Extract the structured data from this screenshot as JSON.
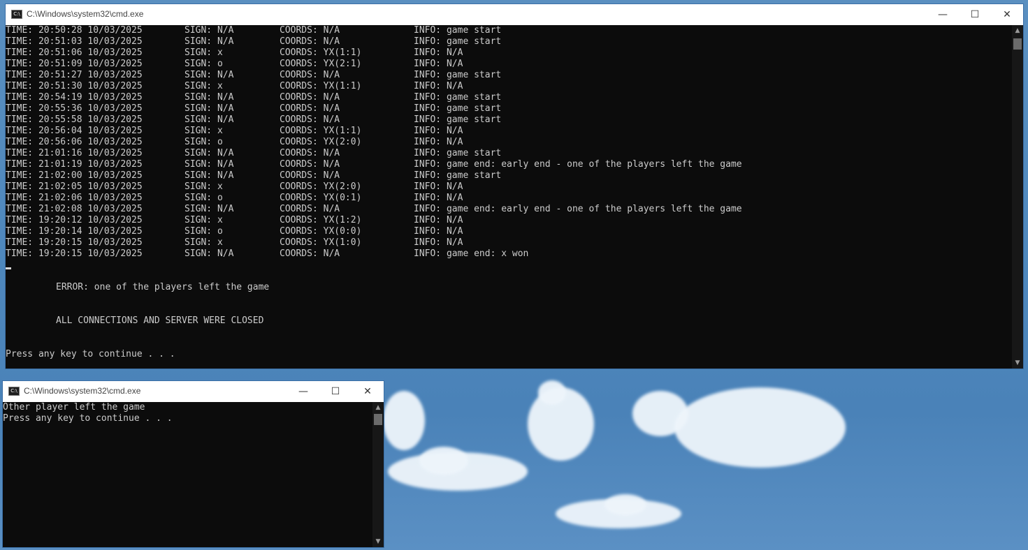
{
  "window1": {
    "title": "C:\\Windows\\system32\\cmd.exe",
    "controls": {
      "minimize": "—",
      "maximize": "☐",
      "close": "✕"
    },
    "log_rows": [
      {
        "time": "TIME: 20:50:28 10/03/2025",
        "sign": "SIGN: N/A",
        "coords": "COORDS: N/A",
        "info": "INFO: game start"
      },
      {
        "time": "TIME: 20:51:03 10/03/2025",
        "sign": "SIGN: N/A",
        "coords": "COORDS: N/A",
        "info": "INFO: game start"
      },
      {
        "time": "TIME: 20:51:06 10/03/2025",
        "sign": "SIGN: x",
        "coords": "COORDS: YX(1:1)",
        "info": "INFO: N/A"
      },
      {
        "time": "TIME: 20:51:09 10/03/2025",
        "sign": "SIGN: o",
        "coords": "COORDS: YX(2:1)",
        "info": "INFO: N/A"
      },
      {
        "time": "TIME: 20:51:27 10/03/2025",
        "sign": "SIGN: N/A",
        "coords": "COORDS: N/A",
        "info": "INFO: game start"
      },
      {
        "time": "TIME: 20:51:30 10/03/2025",
        "sign": "SIGN: x",
        "coords": "COORDS: YX(1:1)",
        "info": "INFO: N/A"
      },
      {
        "time": "TIME: 20:54:19 10/03/2025",
        "sign": "SIGN: N/A",
        "coords": "COORDS: N/A",
        "info": "INFO: game start"
      },
      {
        "time": "TIME: 20:55:36 10/03/2025",
        "sign": "SIGN: N/A",
        "coords": "COORDS: N/A",
        "info": "INFO: game start"
      },
      {
        "time": "TIME: 20:55:58 10/03/2025",
        "sign": "SIGN: N/A",
        "coords": "COORDS: N/A",
        "info": "INFO: game start"
      },
      {
        "time": "TIME: 20:56:04 10/03/2025",
        "sign": "SIGN: x",
        "coords": "COORDS: YX(1:1)",
        "info": "INFO: N/A"
      },
      {
        "time": "TIME: 20:56:06 10/03/2025",
        "sign": "SIGN: o",
        "coords": "COORDS: YX(2:0)",
        "info": "INFO: N/A"
      },
      {
        "time": "TIME: 21:01:16 10/03/2025",
        "sign": "SIGN: N/A",
        "coords": "COORDS: N/A",
        "info": "INFO: game start"
      },
      {
        "time": "TIME: 21:01:19 10/03/2025",
        "sign": "SIGN: N/A",
        "coords": "COORDS: N/A",
        "info": "INFO: game end: early end - one of the players left the game"
      },
      {
        "time": "TIME: 21:02:00 10/03/2025",
        "sign": "SIGN: N/A",
        "coords": "COORDS: N/A",
        "info": "INFO: game start"
      },
      {
        "time": "TIME: 21:02:05 10/03/2025",
        "sign": "SIGN: x",
        "coords": "COORDS: YX(2:0)",
        "info": "INFO: N/A"
      },
      {
        "time": "TIME: 21:02:06 10/03/2025",
        "sign": "SIGN: o",
        "coords": "COORDS: YX(0:1)",
        "info": "INFO: N/A"
      },
      {
        "time": "TIME: 21:02:08 10/03/2025",
        "sign": "SIGN: N/A",
        "coords": "COORDS: N/A",
        "info": "INFO: game end: early end - one of the players left the game"
      },
      {
        "time": "TIME: 19:20:12 10/03/2025",
        "sign": "SIGN: x",
        "coords": "COORDS: YX(1:2)",
        "info": "INFO: N/A"
      },
      {
        "time": "TIME: 19:20:14 10/03/2025",
        "sign": "SIGN: o",
        "coords": "COORDS: YX(0:0)",
        "info": "INFO: N/A"
      },
      {
        "time": "TIME: 19:20:15 10/03/2025",
        "sign": "SIGN: x",
        "coords": "COORDS: YX(1:0)",
        "info": "INFO: N/A"
      },
      {
        "time": "TIME: 19:20:15 10/03/2025",
        "sign": "SIGN: N/A",
        "coords": "COORDS: N/A",
        "info": "INFO: game end: x won"
      }
    ],
    "error_message": "ERROR: one of the players left the game",
    "closed_message": "ALL CONNECTIONS AND SERVER WERE CLOSED",
    "press_key": "Press any key to continue . . ."
  },
  "window2": {
    "title": "C:\\Windows\\system32\\cmd.exe",
    "controls": {
      "minimize": "—",
      "maximize": "☐",
      "close": "✕"
    },
    "line1": "Other player left the game",
    "line2": "Press any key to continue . . ."
  },
  "icons": {
    "cmd": "cmd-app-icon",
    "scroll_up": "▲",
    "scroll_down": "▼"
  },
  "colors": {
    "console_bg": "#0c0c0c",
    "console_text": "#cccccc",
    "titlebar_bg": "#ffffff",
    "desktop_sky": "#4f88bd"
  }
}
